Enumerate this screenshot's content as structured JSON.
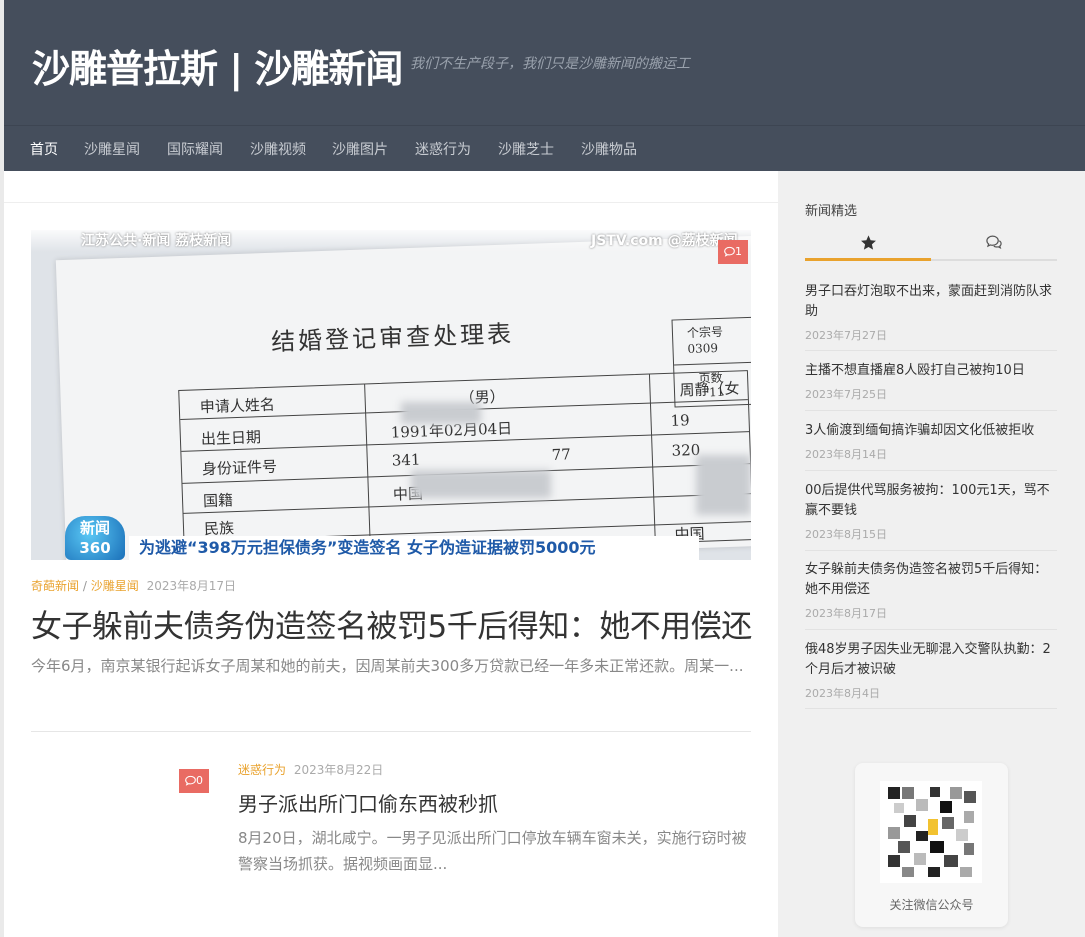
{
  "site": {
    "title": "沙雕普拉斯 | 沙雕新闻",
    "description": "我们不生产段子，我们只是沙雕新闻的搬运工"
  },
  "nav": {
    "items": [
      "首页",
      "沙雕星闻",
      "国际耀闻",
      "沙雕视频",
      "沙雕图片",
      "迷惑行为",
      "沙雕芝士",
      "沙雕物品"
    ],
    "active": "首页"
  },
  "featured_post": {
    "image": {
      "watermark_left": "江苏公共·新闻  荔枝新闻",
      "watermark_right": "JSTV.com @荔枝新闻",
      "doc_title": "结婚登记审查处理表",
      "doc_fields": [
        "申请人姓名",
        "出生日期",
        "身份证件号",
        "国籍",
        "民族"
      ],
      "doc_values": [
        "（男）",
        "1991年02月04日",
        "341",
        "77",
        "中国",
        "中国"
      ],
      "doc_box": [
        "个宗号",
        "0309",
        "页数",
        "11"
      ],
      "doc_right": [
        "周静（女",
        "19",
        "320"
      ],
      "logo": "新闻 360",
      "caption": "为逃避“398万元担保债务”变造签名 女子伪造证据被罚5000元"
    },
    "comment_count": "1",
    "categories": [
      "奇葩新闻",
      "沙雕星闻"
    ],
    "category_separator": "/",
    "date": "2023年8月17日",
    "title": "女子躲前夫债务伪造签名被罚5千后得知：她不用偿还",
    "excerpt": "今年6月，南京某银行起诉女子周某和她的前夫，因周某前夫300多万贷款已经一年多未正常还款。周某一..."
  },
  "second_post": {
    "comment_count": "0",
    "category": "迷惑行为",
    "date": "2023年8月22日",
    "title": "男子派出所门口偷东西被秒抓",
    "excerpt": "8月20日，湖北咸宁。一男子见派出所门口停放车辆车窗未关，实施行窃时被警察当场抓获。据视频画面显..."
  },
  "sidebar": {
    "heading": "新闻精选",
    "tabs": [
      {
        "icon": "star-icon"
      },
      {
        "icon": "comments-icon"
      }
    ],
    "news": [
      {
        "title": "男子口吞灯泡取不出来，蒙面赶到消防队求助",
        "date": "2023年7月27日"
      },
      {
        "title": "主播不想直播雇8人殴打自己被拘10日",
        "date": "2023年7月25日"
      },
      {
        "title": "3人偷渡到缅甸搞诈骗却因文化低被拒收",
        "date": "2023年8月14日"
      },
      {
        "title": "00后提供代骂服务被拘：100元1天，骂不赢不要钱",
        "date": "2023年8月15日"
      },
      {
        "title": "女子躲前夫债务伪造签名被罚5千后得知：她不用偿还",
        "date": "2023年8月17日"
      },
      {
        "title": "俄48岁男子因失业无聊混入交警队执勤：2个月后才被识破",
        "date": "2023年8月4日"
      }
    ],
    "qr_label": "关注微信公众号"
  },
  "colors": {
    "header_bg": "#454e5c",
    "accent": "#e9a22d",
    "comment_badge": "#e96b63"
  }
}
